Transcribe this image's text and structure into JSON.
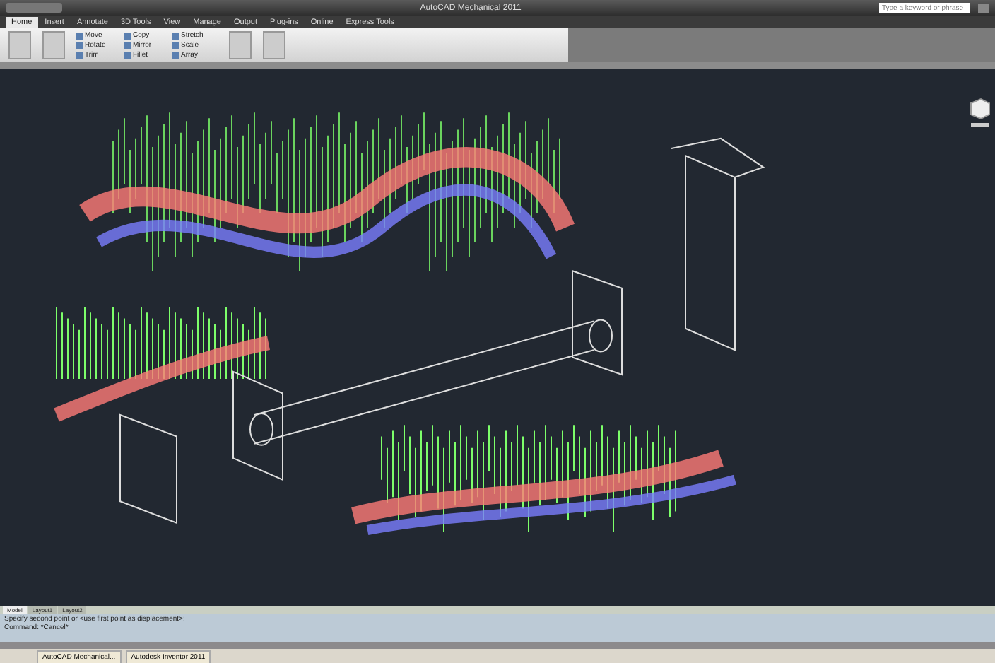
{
  "window": {
    "title": "AutoCAD Mechanical 2011",
    "search": {
      "placeholder": "Type a keyword or phrase"
    }
  },
  "ribbon": {
    "tabs": [
      {
        "label": "Home",
        "selected": true
      },
      {
        "label": "Insert",
        "selected": false
      },
      {
        "label": "Annotate",
        "selected": false
      },
      {
        "label": "3D Tools",
        "selected": false
      },
      {
        "label": "View",
        "selected": false
      },
      {
        "label": "Manage",
        "selected": false
      },
      {
        "label": "Output",
        "selected": false
      },
      {
        "label": "Plug-ins",
        "selected": false
      },
      {
        "label": "Online",
        "selected": false
      },
      {
        "label": "Express Tools",
        "selected": false
      }
    ],
    "tools": [
      {
        "label": "Move"
      },
      {
        "label": "Copy"
      },
      {
        "label": "Stretch"
      },
      {
        "label": "Rotate"
      },
      {
        "label": "Mirror"
      },
      {
        "label": "Scale"
      },
      {
        "label": "Trim"
      },
      {
        "label": "Fillet"
      },
      {
        "label": "Array"
      }
    ]
  },
  "layout_tabs": [
    {
      "label": "Model",
      "selected": true
    },
    {
      "label": "Layout1",
      "selected": false
    },
    {
      "label": "Layout2",
      "selected": false
    }
  ],
  "command_line": [
    "Specify second point or <use first point as displacement>:",
    "Command: *Cancel*"
  ],
  "taskbar": [
    {
      "label": "AutoCAD Mechanical..."
    },
    {
      "label": "Autodesk Inventor 2011"
    }
  ]
}
